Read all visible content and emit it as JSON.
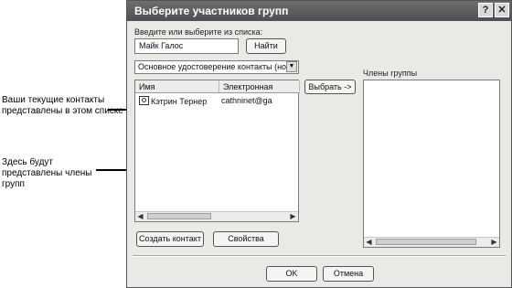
{
  "callouts": {
    "contacts_text": "Ваши текущие контакты представлены в этом списке",
    "members_text": "Здесь будут представлены члены групп"
  },
  "dialog": {
    "title": "Выберите участников групп",
    "help_glyph": "?",
    "close_glyph": "✕",
    "search_label": "Введите или выберите из списка:",
    "search_value": "Майк Галос",
    "find_button": "Найти",
    "address_book": "Основное удостоверение контакты (нов",
    "col_name": "Имя",
    "col_email": "Электронная",
    "contacts": [
      {
        "name": "Кэтрин Тернер",
        "email": "cathninet@ga"
      }
    ],
    "select_button": "Выбрать ->",
    "members_label": "Члены группы",
    "new_contact_button": "Создать контакт",
    "properties_button": "Свойства",
    "ok_button": "OK",
    "cancel_button": "Отмена"
  }
}
